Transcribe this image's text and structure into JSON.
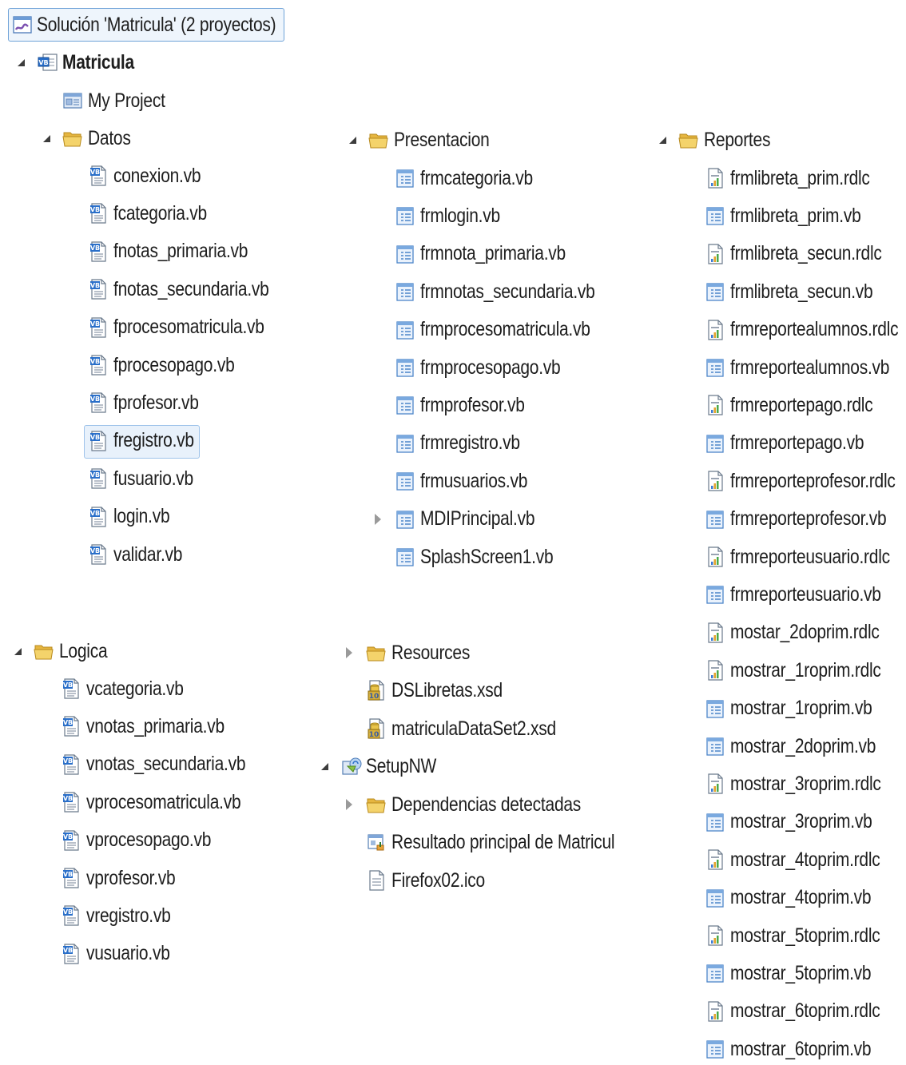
{
  "solution": {
    "label": "Solución 'Matricula' (2 proyectos)"
  },
  "project": {
    "label": "Matricula"
  },
  "my_project": {
    "label": "My Project"
  },
  "datos": {
    "label": "Datos",
    "items": [
      "conexion.vb",
      "fcategoria.vb",
      "fnotas_primaria.vb",
      "fnotas_secundaria.vb",
      "fprocesomatricula.vb",
      "fprocesopago.vb",
      "fprofesor.vb",
      "fregistro.vb",
      "fusuario.vb",
      "login.vb",
      "validar.vb"
    ],
    "selected": "fregistro.vb"
  },
  "logica": {
    "label": "Logica",
    "items": [
      "vcategoria.vb",
      "vnotas_primaria.vb",
      "vnotas_secundaria.vb",
      "vprocesomatricula.vb",
      "vprocesopago.vb",
      "vprofesor.vb",
      "vregistro.vb",
      "vusuario.vb"
    ]
  },
  "presentacion": {
    "label": "Presentacion",
    "items": [
      "frmcategoria.vb",
      "frmlogin.vb",
      "frmnota_primaria.vb",
      "frmnotas_secundaria.vb",
      "frmprocesomatricula.vb",
      "frmprocesopago.vb",
      "frmprofesor.vb",
      "frmregistro.vb",
      "frmusuarios.vb",
      "MDIPrincipal.vb",
      "SplashScreen1.vb"
    ],
    "collapsed_item": "MDIPrincipal.vb"
  },
  "extras": {
    "resources": "Resources",
    "dslibretas": "DSLibretas.xsd",
    "dataset": "matriculaDataSet2.xsd"
  },
  "setup": {
    "label": "SetupNW",
    "dependencias": "Dependencias detectadas",
    "resultado": "Resultado principal de Matricul",
    "firefox": "Firefox02.ico"
  },
  "reportes": {
    "label": "Reportes",
    "items": [
      "frmlibreta_prim.rdlc",
      "frmlibreta_prim.vb",
      "frmlibreta_secun.rdlc",
      "frmlibreta_secun.vb",
      "frmreportealumnos.rdlc",
      "frmreportealumnos.vb",
      "frmreportepago.rdlc",
      "frmreportepago.vb",
      "frmreporteprofesor.rdlc",
      "frmreporteprofesor.vb",
      "frmreporteusuario.rdlc",
      "frmreporteusuario.vb",
      "mostar_2doprim.rdlc",
      "mostrar_1roprim.rdlc",
      "mostrar_1roprim.vb",
      "mostrar_2doprim.vb",
      "mostrar_3roprim.rdlc",
      "mostrar_3roprim.vb",
      "mostrar_4toprim.rdlc",
      "mostrar_4toprim.vb",
      "mostrar_5toprim.rdlc",
      "mostrar_5toprim.vb",
      "mostrar_6toprim.rdlc",
      "mostrar_6toprim.vb"
    ]
  },
  "colors": {
    "folder": "#f2cd5c",
    "vb_accent": "#2a6fc9",
    "selection": "#e8f1fb",
    "selection_border": "#9ec3ea"
  }
}
